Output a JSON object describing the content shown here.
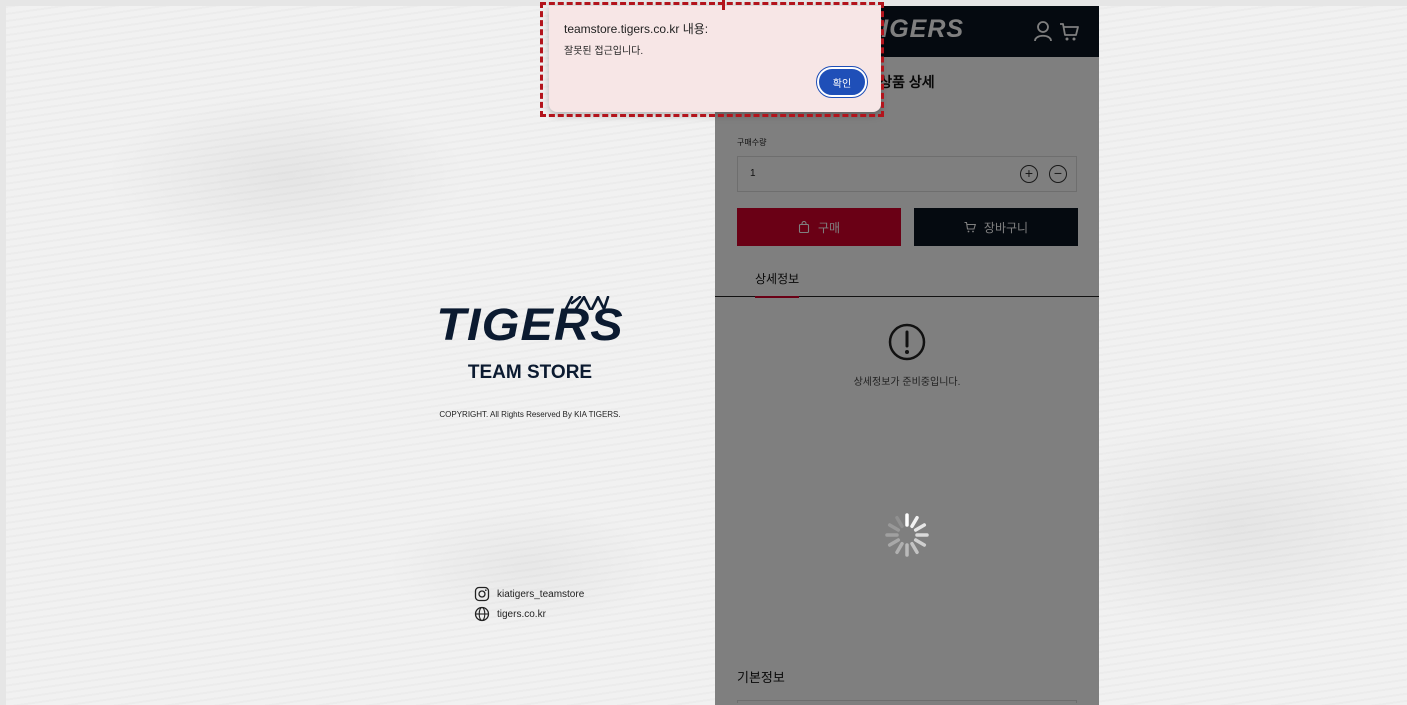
{
  "brand": {
    "logo": "TIGERS",
    "subtitle": "TEAM STORE",
    "copyright": "COPYRIGHT. All Rights Reserved By KIA TIGERS."
  },
  "social": {
    "instagram": "kiatigers_teamstore",
    "website": "tigers.co.kr"
  },
  "panel": {
    "topbar_logo": "TIGERS",
    "page_title": "상품 상세",
    "quantity_label": "구매수량",
    "quantity_value": "1",
    "buy_label": "구매",
    "cart_label": "장바구니",
    "tab_detail": "상세정보",
    "notice_text": "상세정보가 준비중입니다.",
    "basic_info": "기본정보"
  },
  "dialog": {
    "title": "teamstore.tigers.co.kr 내용:",
    "message": "잘못된 접근입니다.",
    "ok_label": "확인"
  },
  "colors": {
    "navy": "#0b1420",
    "brand_red": "#d4002a",
    "dialog_bg": "#f7e6e6",
    "ok_blue": "#1f4fb8",
    "highlight_red": "#b3141c"
  }
}
